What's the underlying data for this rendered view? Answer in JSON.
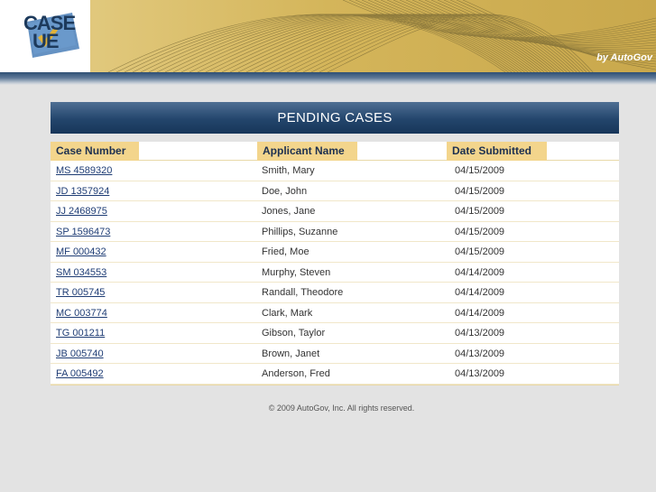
{
  "header": {
    "logo": {
      "line1": "CASE",
      "line2": "UE",
      "accent_letter": "V"
    },
    "byline": "by AutoGov"
  },
  "panel": {
    "title": "PENDING CASES"
  },
  "table": {
    "columns": [
      "Case Number",
      "Applicant Name",
      "Date Submitted"
    ],
    "rows": [
      {
        "case_number": "MS 4589320",
        "applicant": "Smith, Mary",
        "date": "04/15/2009"
      },
      {
        "case_number": "JD 1357924",
        "applicant": "Doe, John",
        "date": "04/15/2009"
      },
      {
        "case_number": "JJ 2468975",
        "applicant": "Jones, Jane",
        "date": "04/15/2009"
      },
      {
        "case_number": "SP 1596473",
        "applicant": "Phillips, Suzanne",
        "date": "04/15/2009"
      },
      {
        "case_number": "MF 000432",
        "applicant": "Fried, Moe",
        "date": "04/15/2009"
      },
      {
        "case_number": "SM 034553",
        "applicant": "Murphy, Steven",
        "date": "04/14/2009"
      },
      {
        "case_number": "TR 005745",
        "applicant": "Randall, Theodore",
        "date": "04/14/2009"
      },
      {
        "case_number": "MC 003774",
        "applicant": "Clark, Mark",
        "date": "04/14/2009"
      },
      {
        "case_number": "TG 001211",
        "applicant": "Gibson, Taylor",
        "date": "04/13/2009"
      },
      {
        "case_number": "JB 005740",
        "applicant": "Brown, Janet",
        "date": "04/13/2009"
      },
      {
        "case_number": "FA 005492",
        "applicant": "Anderson, Fred",
        "date": "04/13/2009"
      }
    ]
  },
  "footer": {
    "text": "© 2009 AutoGov, Inc.  All rights reserved."
  },
  "colors": {
    "header_gold": "#d8bd66",
    "navy": "#23456c",
    "column_header": "#f3d58c",
    "link": "#1f3d75",
    "page_bg": "#e3e3e3"
  },
  "icons": {
    "logo_check": "checkmark-icon"
  }
}
